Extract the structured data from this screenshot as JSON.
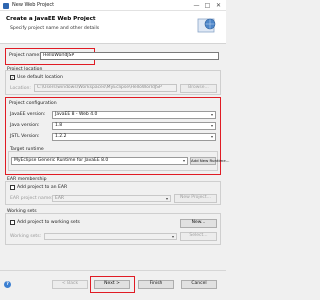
{
  "window": {
    "title": "New Web Project",
    "buttons": {
      "minimize": "—",
      "maximize": "□",
      "close": "✕"
    }
  },
  "header": {
    "title": "Create a JavaEE Web Project",
    "subtitle": "Specify project name and other details"
  },
  "project_name": {
    "label": "Project name:",
    "value": "HelloWorldJSP"
  },
  "project_location": {
    "section": "Project location",
    "use_default_label": "Use default location",
    "use_default_checked": true,
    "location_label": "Location:",
    "location_value": "C:\\Users\\windows\\Workspaces\\MyEclipse\\HelloWorldJSP",
    "browse_label": "Browse..."
  },
  "project_configuration": {
    "section": "Project configuration",
    "javaee_label": "JavaEE version:",
    "javaee_value": "JavaEE 8 - Web 4.0",
    "java_label": "Java version:",
    "java_value": "1.8",
    "jstl_label": "JSTL Version:",
    "jstl_value": "1.2.2",
    "target_runtime_section": "Target runtime",
    "runtime_value": "MyEclipse Generic Runtime for JavaEE 8.0",
    "new_runtime_label": "Add New Runtime..."
  },
  "ear": {
    "section": "EAR membership",
    "add_label": "Add project to an EAR",
    "name_label": "EAR project name:",
    "name_value": "EAR",
    "new_project_label": "New Project..."
  },
  "working_sets": {
    "section": "Working sets",
    "add_label": "Add project to working sets",
    "sets_label": "Working sets:",
    "new_label": "New...",
    "select_label": "Select..."
  },
  "footer": {
    "help": "?",
    "back_label": "< Back",
    "next_label": "Next >",
    "finish_label": "Finish",
    "cancel_label": "Cancel"
  },
  "colors": {
    "highlight": "#e01b24",
    "accent": "#2e66b0"
  }
}
